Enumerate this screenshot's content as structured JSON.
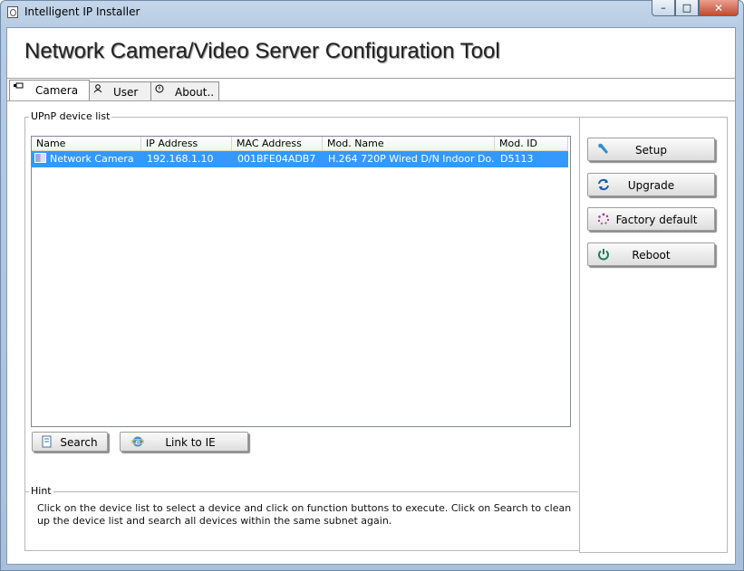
{
  "window": {
    "title": "Intelligent IP Installer",
    "minimize_glyph": "–",
    "maximize_glyph": "□",
    "close_glyph": "✕"
  },
  "header": {
    "title": "Network Camera/Video Server Configuration Tool"
  },
  "tabs": [
    {
      "label": "Camera",
      "icon": "camera-icon",
      "active": true
    },
    {
      "label": "User",
      "icon": "user-icon",
      "active": false
    },
    {
      "label": "About..",
      "icon": "info-icon",
      "active": false
    }
  ],
  "device_list": {
    "legend": "UPnP device list",
    "columns": [
      "Name",
      "IP Address",
      "MAC Address",
      "Mod. Name",
      "Mod. ID"
    ],
    "rows": [
      {
        "name": "Network Camera",
        "ip": "192.168.1.10",
        "mac": "001BFE04ADB7",
        "model_name": "H.264 720P Wired D/N Indoor Do...",
        "model_id": "D5113",
        "selected": true
      }
    ]
  },
  "buttons": {
    "search": "Search",
    "link_ie": "Link to IE",
    "setup": "Setup",
    "upgrade": "Upgrade",
    "factory_default": "Factory default",
    "reboot": "Reboot"
  },
  "hint": {
    "legend": "Hint",
    "text": "Click on the device list to select a device and click on function buttons to execute. Click on Search to clean up the device list and search all devices  within the same subnet again."
  },
  "colors": {
    "selection": "#3399ff",
    "frame": "#b7cce3",
    "close_button": "#c44a2f"
  }
}
